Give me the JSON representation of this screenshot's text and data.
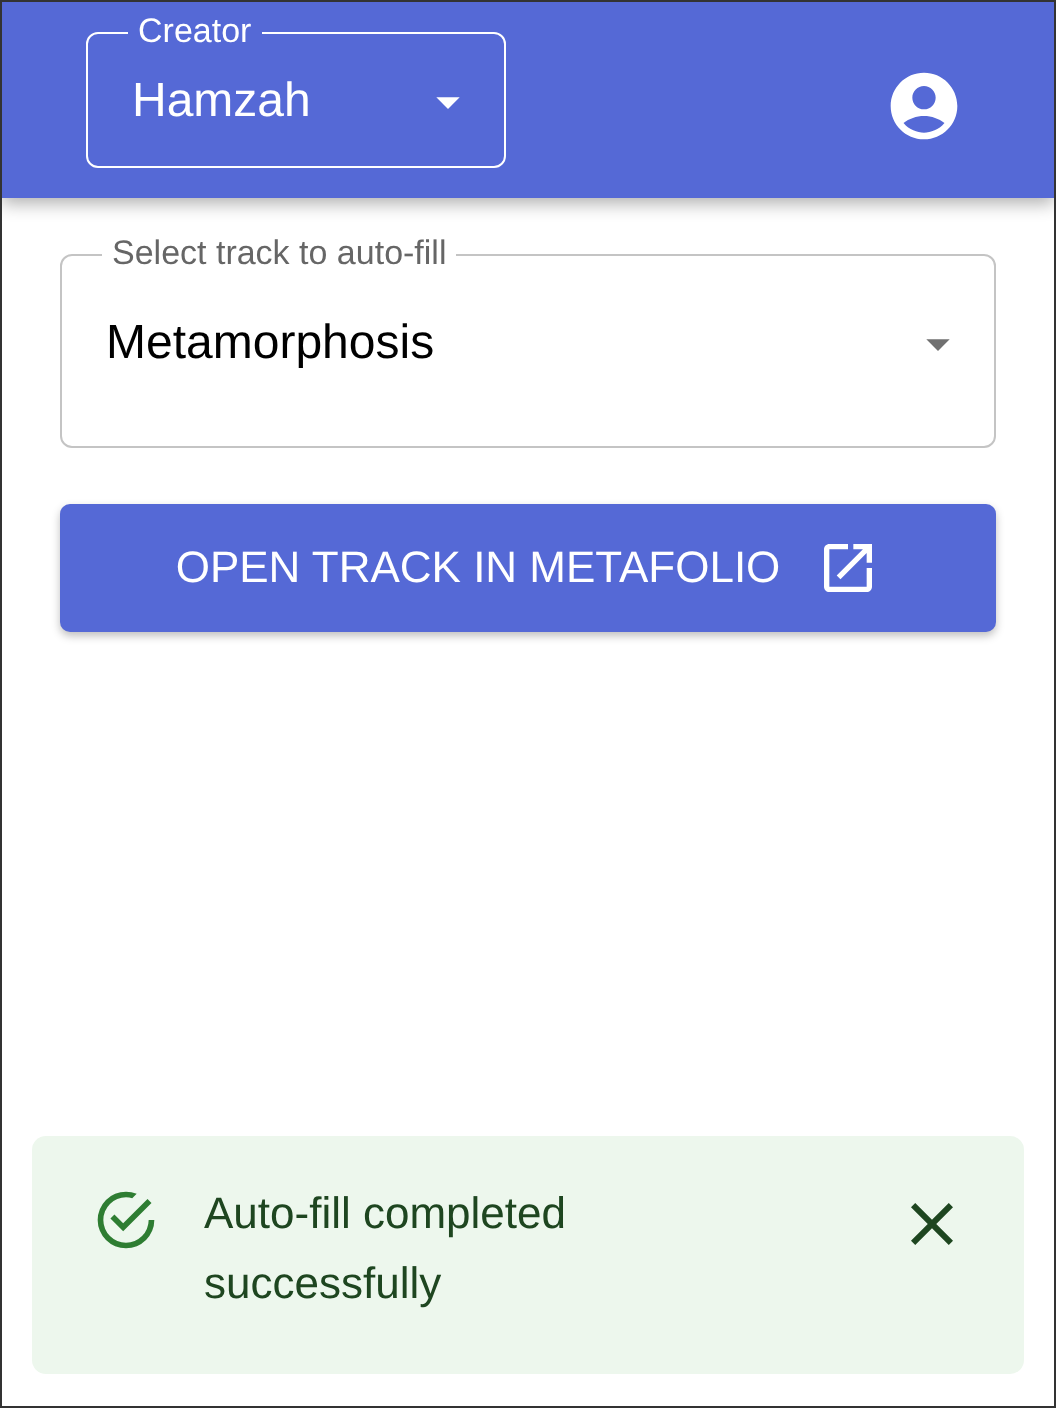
{
  "header": {
    "creator_select": {
      "label": "Creator",
      "value": "Hamzah"
    }
  },
  "track_select": {
    "label": "Select track to auto-fill",
    "value": "Metamorphosis"
  },
  "open_button": {
    "label": "OPEN TRACK IN METAFOLIO"
  },
  "alert": {
    "kind": "success",
    "message": "Auto-fill completed successfully"
  }
}
